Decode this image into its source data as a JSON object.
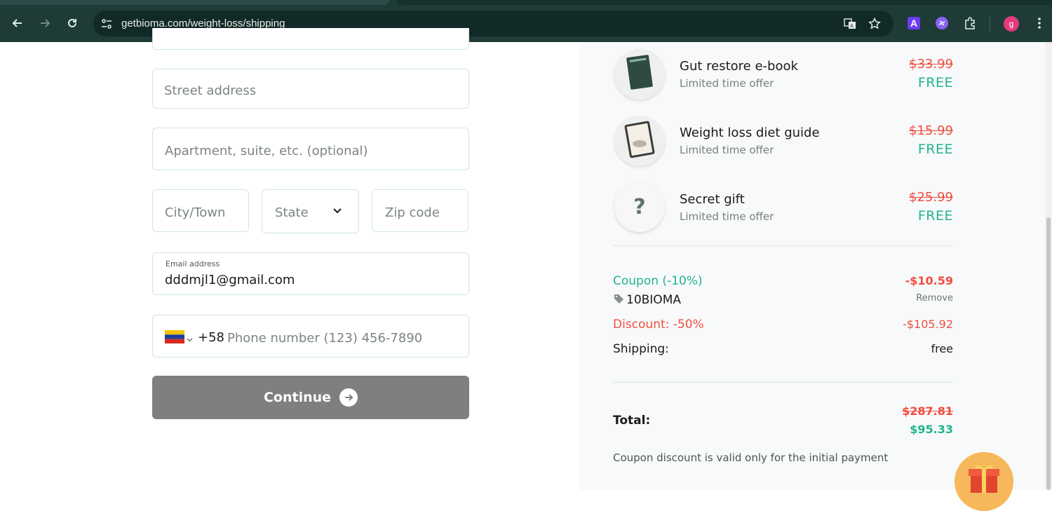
{
  "browser": {
    "url": "getbioma.com/weight-loss/shipping",
    "extension_a_label": "A",
    "profile_initial": "g"
  },
  "form": {
    "street_placeholder": "Street address",
    "apartment_placeholder": "Apartment, suite, etc. (optional)",
    "city_placeholder": "City/Town",
    "state_value": "State",
    "zip_placeholder": "Zip code",
    "email_label": "Email address",
    "email_value": "dddmjl1@gmail.com",
    "phone_code": "+58",
    "phone_placeholder": "Phone number (123) 456-7890",
    "continue_label": "Continue"
  },
  "order": {
    "items": [
      {
        "title": "Gut restore e-book",
        "subtitle": "Limited time offer",
        "old_price": "$33.99",
        "price": "FREE"
      },
      {
        "title": "Weight loss diet guide",
        "subtitle": "Limited time offer",
        "old_price": "$15.99",
        "price": "FREE"
      },
      {
        "title": "Secret gift",
        "subtitle": "Limited time offer",
        "old_price": "$25.99",
        "price": "FREE",
        "image_glyph": "?"
      }
    ],
    "coupon_label": "Coupon (-10%)",
    "coupon_value": "-$10.59",
    "coupon_code": "10BIOMA",
    "remove_label": "Remove",
    "discount_label": "Discount: -50%",
    "discount_value": "-$105.92",
    "shipping_label": "Shipping:",
    "shipping_value": "free",
    "total_label": "Total:",
    "total_old": "$287.81",
    "total_new": "$95.33",
    "coupon_note": "Coupon discount is valid only for the initial payment"
  },
  "colors": {
    "brand_green": "#1fb58a",
    "red": "#ef4e3f",
    "chrome_bg": "#1e3b38",
    "button_gray": "#7f7f7f"
  }
}
